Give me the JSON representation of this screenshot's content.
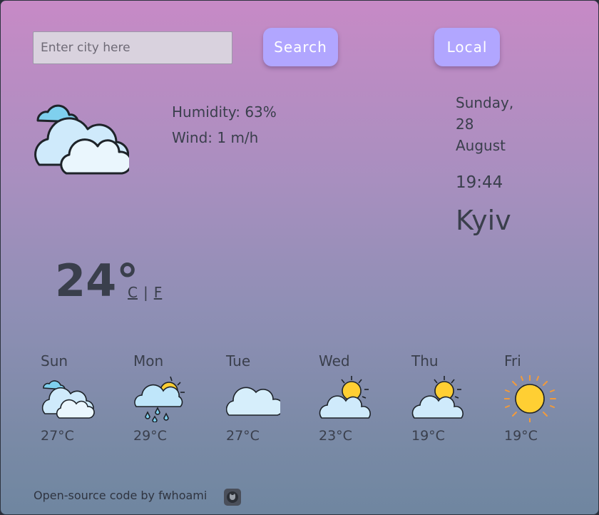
{
  "search": {
    "placeholder": "Enter city here",
    "value": ""
  },
  "buttons": {
    "search_label": "Search",
    "local_label": "Local"
  },
  "current": {
    "icon": "cloudy-icon",
    "humidity": "Humidity: 63%",
    "wind": "Wind: 1 m/h",
    "temperature": "24°",
    "unit_c": "C",
    "unit_sep": "|",
    "unit_f": "F"
  },
  "date": {
    "weekday": "Sunday,",
    "day": "28",
    "month": "August",
    "time": "19:44",
    "city": "Kyiv"
  },
  "forecast": [
    {
      "day": "Sun",
      "temp": "27°C",
      "icon": "cloudy-icon"
    },
    {
      "day": "Mon",
      "temp": "29°C",
      "icon": "rain-sun-icon"
    },
    {
      "day": "Tue",
      "temp": "27°C",
      "icon": "cloud-icon"
    },
    {
      "day": "Wed",
      "temp": "23°C",
      "icon": "partly-sunny-icon"
    },
    {
      "day": "Thu",
      "temp": "19°C",
      "icon": "partly-sunny-icon"
    },
    {
      "day": "Fri",
      "temp": "19°C",
      "icon": "sun-icon"
    }
  ],
  "footer": {
    "text": "Open-source code by fwhoami",
    "icon": "github-icon"
  },
  "colors": {
    "accent": "#b1a6ff",
    "text": "#3a3f4c",
    "sun": "#ffcf33",
    "cloud": "#d6eefb"
  }
}
